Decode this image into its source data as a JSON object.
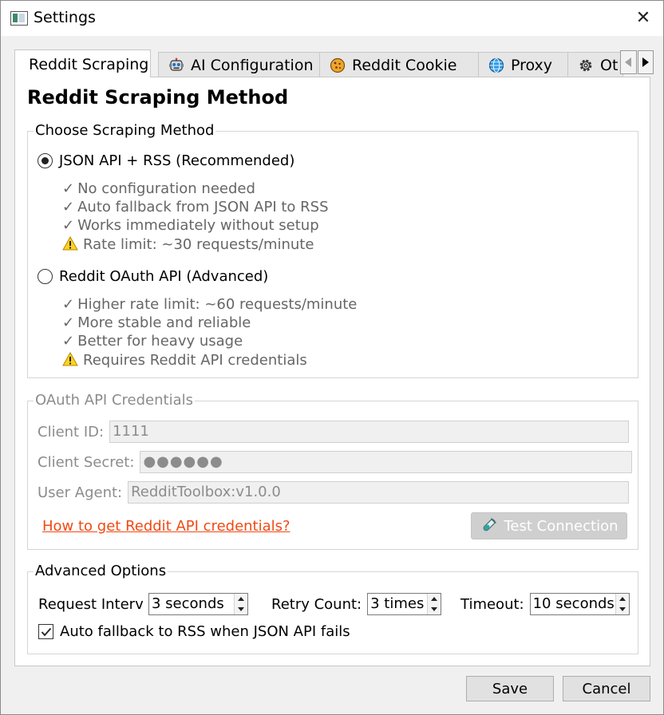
{
  "window": {
    "title": "Settings",
    "close_glyph": "✕"
  },
  "tabs": [
    {
      "label": "Reddit Scraping",
      "icon": "none",
      "active": true
    },
    {
      "label": "AI Configuration",
      "icon": "robot-icon"
    },
    {
      "label": "Reddit Cookie",
      "icon": "cookie-icon"
    },
    {
      "label": "Proxy",
      "icon": "globe-icon"
    },
    {
      "label": "Ot",
      "icon": "gear-icon"
    }
  ],
  "page": {
    "heading": "Reddit Scraping Method"
  },
  "method_group": {
    "legend": "Choose Scraping Method",
    "options": [
      {
        "label": "JSON API + RSS (Recommended)",
        "selected": true,
        "features": [
          {
            "mark": "✓",
            "text": "No configuration needed"
          },
          {
            "mark": "✓",
            "text": "Auto fallback from JSON API to RSS"
          },
          {
            "mark": "✓",
            "text": "Works immediately without setup"
          },
          {
            "mark": "warning",
            "text": "Rate limit: ~30 requests/minute"
          }
        ]
      },
      {
        "label": "Reddit OAuth API (Advanced)",
        "selected": false,
        "features": [
          {
            "mark": "✓",
            "text": "Higher rate limit: ~60 requests/minute"
          },
          {
            "mark": "✓",
            "text": "More stable and reliable"
          },
          {
            "mark": "✓",
            "text": "Better for heavy usage"
          },
          {
            "mark": "warning",
            "text": "Requires Reddit API credentials"
          }
        ]
      }
    ]
  },
  "oauth_group": {
    "legend": "OAuth API Credentials",
    "client_id_label": "Client ID:",
    "client_id_value": "1111",
    "client_secret_label": "Client Secret:",
    "client_secret_value": "●●●●●●",
    "user_agent_label": "User Agent:",
    "user_agent_value": "RedditToolbox:v1.0.0",
    "help_link": "How to get Reddit API credentials?",
    "test_button": "Test Connection"
  },
  "advanced_group": {
    "legend": "Advanced Options",
    "request_interval_label": "Request Interva",
    "request_interval_value": "3 seconds",
    "retry_count_label": "Retry Count:",
    "retry_count_value": "3 times",
    "timeout_label": "Timeout:",
    "timeout_value": "10 seconds",
    "fallback_label": "Auto fallback to RSS when JSON API fails",
    "fallback_checked": true
  },
  "footer": {
    "save_label": "Save",
    "cancel_label": "Cancel"
  },
  "colors": {
    "link": "#f04a14",
    "disabled_text": "#8c8c8c",
    "feature_text": "#666666"
  }
}
